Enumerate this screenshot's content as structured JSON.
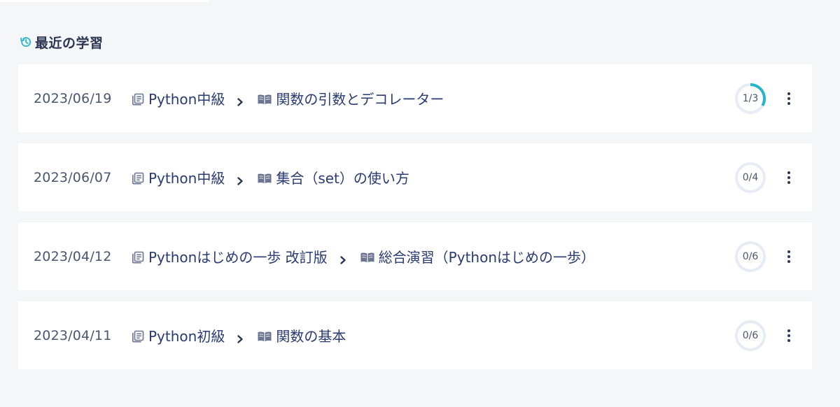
{
  "recent": {
    "title": "最近の学習",
    "icon": "history-icon",
    "accent_color": "#26b5c8",
    "items": [
      {
        "date": "2023/06/19",
        "course": "Python中級",
        "lesson": "関数の引数とデコレーター",
        "progress_label": "1/3",
        "progress_fraction": 0.333
      },
      {
        "date": "2023/06/07",
        "course": "Python中級",
        "lesson": "集合（set）の使い方",
        "progress_label": "0/4",
        "progress_fraction": 0
      },
      {
        "date": "2023/04/12",
        "course": "Pythonはじめの一歩 改訂版",
        "lesson": "総合演習（Pythonはじめの一歩）",
        "progress_label": "0/6",
        "progress_fraction": 0
      },
      {
        "date": "2023/04/11",
        "course": "Python初級",
        "lesson": "関数の基本",
        "progress_label": "0/6",
        "progress_fraction": 0
      }
    ]
  },
  "icons": {
    "course": "document-list-icon",
    "lesson": "open-book-icon",
    "separator": "chevron-right-icon",
    "menu": "more-vertical-icon"
  },
  "colors": {
    "background": "#f5f6f8",
    "card": "#ffffff",
    "text_primary": "#2a3a73",
    "text_muted": "#4a5570",
    "ring_track": "#e6ecf5",
    "ring_fill": "#26b5c8"
  }
}
